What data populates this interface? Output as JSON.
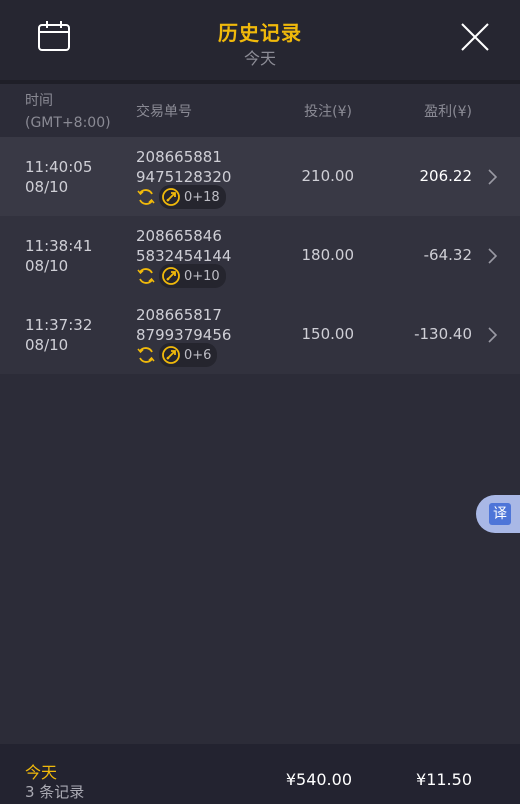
{
  "header": {
    "title": "历史记录",
    "subtitle": "今天",
    "calendar_icon": "calendar-icon",
    "close_icon": "close-icon"
  },
  "columns": {
    "time_line1": "时间",
    "time_line2": "(GMT+8:00)",
    "order": "交易单号",
    "bet": "投注(¥)",
    "profit": "盈利(¥)"
  },
  "rows": [
    {
      "time": "11:40:05",
      "date": "08/10",
      "order_line1": "208665881",
      "order_line2": "9475128320",
      "count": "0+18",
      "bet": "210.00",
      "profit": "206.22"
    },
    {
      "time": "11:38:41",
      "date": "08/10",
      "order_line1": "208665846",
      "order_line2": "5832454144",
      "count": "0+10",
      "bet": "180.00",
      "profit": "-64.32"
    },
    {
      "time": "11:37:32",
      "date": "08/10",
      "order_line1": "208665817",
      "order_line2": "8799379456",
      "count": "0+6",
      "bet": "150.00",
      "profit": "-130.40"
    }
  ],
  "translate": {
    "label": "译"
  },
  "footer": {
    "today": "今天",
    "record_count": "3 条记录",
    "total_bet": "¥540.00",
    "total_profit": "¥11.50"
  },
  "colors": {
    "accent": "#f0b90b",
    "background": "#2c2c38",
    "header_bg": "#262631",
    "translate_blue": "#4e75d8"
  }
}
